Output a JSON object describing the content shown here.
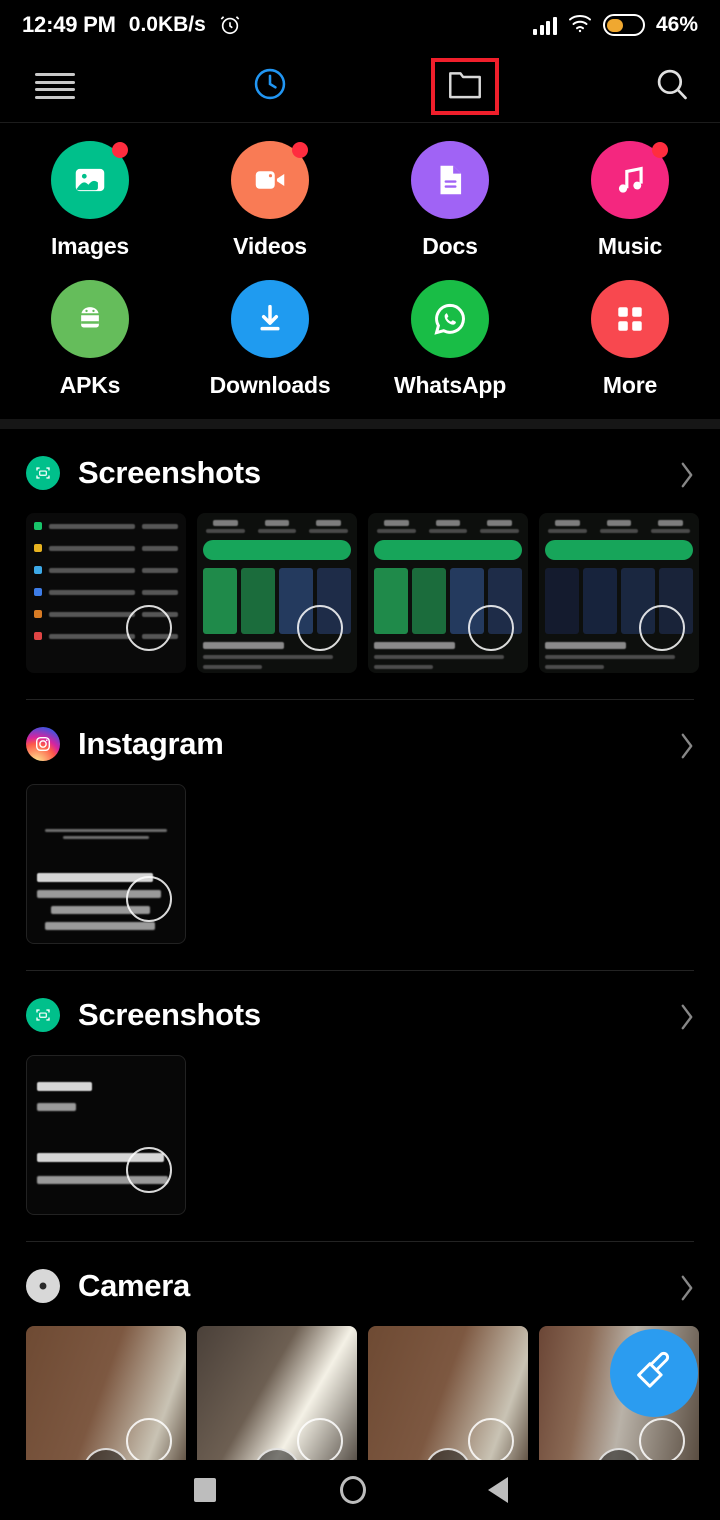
{
  "status_bar": {
    "time": "12:49 PM",
    "network_speed": "0.0KB/s",
    "alarm_icon": "alarm-icon",
    "signal_icon": "signal-icon",
    "wifi_icon": "wifi-icon",
    "battery_icon": "battery-icon",
    "battery_percent": "46%",
    "battery_level": 46,
    "battery_color": "#f0a830"
  },
  "toolbar": {
    "menu_icon": "hamburger-menu-icon",
    "recent_icon": "clock-recent-icon",
    "recent_color": "#2196f3",
    "folder_icon": "folder-icon",
    "search_icon": "search-icon",
    "highlight_color": "#f01f2b",
    "highlighted_item": "folder-icon"
  },
  "categories": [
    {
      "label": "Images",
      "icon": "image-icon",
      "color": "#00c08b",
      "badge": true
    },
    {
      "label": "Videos",
      "icon": "video-icon",
      "color": "#f97b55",
      "badge": true
    },
    {
      "label": "Docs",
      "icon": "document-icon",
      "color": "#a063f5",
      "badge": false
    },
    {
      "label": "Music",
      "icon": "music-note-icon",
      "color": "#f4277f",
      "badge": true
    },
    {
      "label": "APKs",
      "icon": "android-icon",
      "color": "#65bd5b",
      "badge": false
    },
    {
      "label": "Downloads",
      "icon": "download-icon",
      "color": "#1f9bf0",
      "badge": false
    },
    {
      "label": "WhatsApp",
      "icon": "whatsapp-icon",
      "color": "#19bd46",
      "badge": false
    },
    {
      "label": "More",
      "icon": "grid-icon",
      "color": "#f8484f",
      "badge": false
    }
  ],
  "sections": [
    {
      "title": "Screenshots",
      "icon": "screenshot-icon",
      "icon_color": "#00c08b",
      "chevron_icon": "chevron-right-icon",
      "thumbnails": [
        {
          "kind": "settings-screenshot",
          "name": "thumbnail-settings"
        },
        {
          "kind": "playstore-screenshot",
          "name": "thumbnail-playstore-1"
        },
        {
          "kind": "playstore-screenshot",
          "name": "thumbnail-playstore-2"
        },
        {
          "kind": "playstore-screenshot",
          "name": "thumbnail-playstore-3"
        }
      ]
    },
    {
      "title": "Instagram",
      "icon": "instagram-icon",
      "icon_color": "#e1306c",
      "chevron_icon": "chevron-right-icon",
      "thumbnails": [
        {
          "kind": "post-screenshot",
          "name": "thumbnail-instagram-post"
        }
      ]
    },
    {
      "title": "Screenshots",
      "icon": "screenshot-icon",
      "icon_color": "#00c08b",
      "chevron_icon": "chevron-right-icon",
      "thumbnails": [
        {
          "kind": "post-screenshot-zoom",
          "name": "thumbnail-instagram-post-zoom"
        }
      ]
    },
    {
      "title": "Camera",
      "icon": "camera-icon",
      "icon_color": "#d8d8d8",
      "chevron_icon": "chevron-right-icon",
      "thumbnails": [
        {
          "kind": "video",
          "name": "thumbnail-video-1"
        },
        {
          "kind": "video",
          "name": "thumbnail-video-2"
        },
        {
          "kind": "video",
          "name": "thumbnail-video-3"
        },
        {
          "kind": "video",
          "name": "thumbnail-video-4"
        }
      ]
    }
  ],
  "fab": {
    "icon": "cleaner-brush-icon",
    "color": "#2b9cf0"
  },
  "nav_bar": {
    "recents_icon": "square-recents-icon",
    "home_icon": "circle-home-icon",
    "back_icon": "triangle-back-icon",
    "color": "#bdbdbd"
  }
}
